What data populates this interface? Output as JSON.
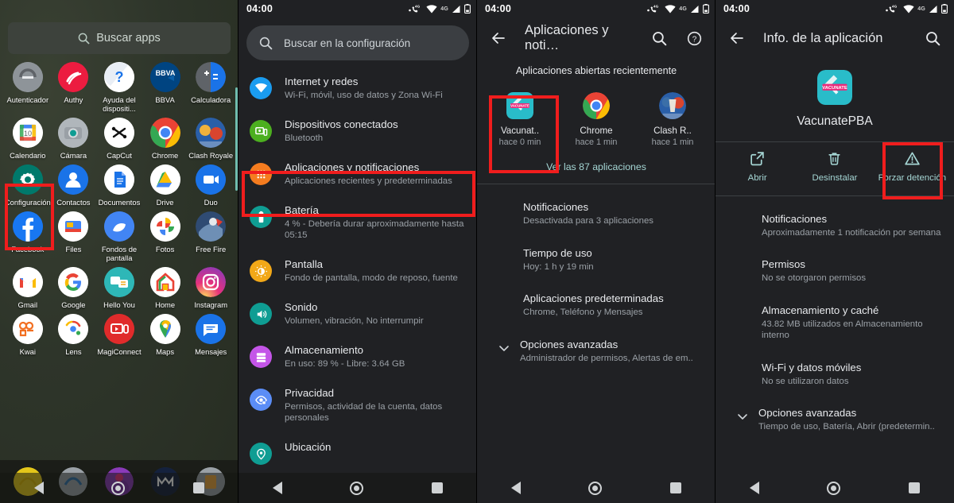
{
  "status_bar": {
    "time": "04:00",
    "network_label": "4G",
    "icons": [
      "phone-4g-icon",
      "wifi-icon",
      "signal-icon",
      "battery-icon"
    ]
  },
  "panel1": {
    "name": "App drawer",
    "search": {
      "placeholder": "Buscar apps",
      "icon": "search-icon"
    },
    "apps": [
      [
        {
          "label": "Autenticador",
          "icon": "authenticator-icon"
        },
        {
          "label": "Authy",
          "icon": "authy-icon"
        },
        {
          "label": "Ayuda del dispositi...",
          "icon": "device-help-icon"
        },
        {
          "label": "BBVA",
          "icon": "bbva-icon"
        },
        {
          "label": "Calculadora",
          "icon": "calculator-icon"
        }
      ],
      [
        {
          "label": "Calendario",
          "icon": "calendar-icon"
        },
        {
          "label": "Cámara",
          "icon": "camera-icon"
        },
        {
          "label": "CapCut",
          "icon": "capcut-icon"
        },
        {
          "label": "Chrome",
          "icon": "chrome-icon"
        },
        {
          "label": "Clash Royale",
          "icon": "clash-royale-icon"
        }
      ],
      [
        {
          "label": "Configuración",
          "icon": "settings-gear-icon"
        },
        {
          "label": "Contactos",
          "icon": "contacts-icon"
        },
        {
          "label": "Documentos",
          "icon": "docs-icon"
        },
        {
          "label": "Drive",
          "icon": "drive-icon"
        },
        {
          "label": "Duo",
          "icon": "duo-icon"
        }
      ],
      [
        {
          "label": "Facebook",
          "icon": "facebook-icon"
        },
        {
          "label": "Files",
          "icon": "files-icon"
        },
        {
          "label": "Fondos de pantalla",
          "icon": "wallpapers-icon"
        },
        {
          "label": "Fotos",
          "icon": "photos-icon"
        },
        {
          "label": "Free Fire",
          "icon": "free-fire-icon"
        }
      ],
      [
        {
          "label": "Gmail",
          "icon": "gmail-icon"
        },
        {
          "label": "Google",
          "icon": "google-icon"
        },
        {
          "label": "Hello You",
          "icon": "hello-you-icon"
        },
        {
          "label": "Home",
          "icon": "home-icon"
        },
        {
          "label": "Instagram",
          "icon": "instagram-icon"
        }
      ],
      [
        {
          "label": "Kwai",
          "icon": "kwai-icon"
        },
        {
          "label": "Lens",
          "icon": "lens-icon"
        },
        {
          "label": "MagiConnect",
          "icon": "magiconnect-icon"
        },
        {
          "label": "Maps",
          "icon": "maps-icon"
        },
        {
          "label": "Mensajes",
          "icon": "messages-icon"
        }
      ]
    ],
    "dock": [
      "dock-icon-1",
      "dock-icon-2",
      "dock-icon-3",
      "dock-icon-4",
      "dock-icon-5"
    ],
    "highlight": "Configuración"
  },
  "panel2": {
    "name": "Configuración",
    "search": {
      "placeholder": "Buscar en la configuración",
      "icon": "search-icon"
    },
    "items": [
      {
        "title": "Internet y redes",
        "subtitle": "Wi-Fi, móvil, uso de datos y Zona Wi-Fi",
        "icon": "wifi-icon",
        "color": "#1a9cf0"
      },
      {
        "title": "Dispositivos conectados",
        "subtitle": "Bluetooth",
        "icon": "devices-icon",
        "color": "#4caf1f"
      },
      {
        "title": "Aplicaciones y notificaciones",
        "subtitle": "Aplicaciones recientes y predeterminadas",
        "icon": "apps-grid-icon",
        "color": "#f57c1f"
      },
      {
        "title": "Batería",
        "subtitle": "4 % - Debería durar aproximadamente hasta 05:15",
        "icon": "battery-icon",
        "color": "#0f9d93"
      },
      {
        "title": "Pantalla",
        "subtitle": "Fondo de pantalla, modo de reposo, fuente",
        "icon": "brightness-icon",
        "color": "#f2a818"
      },
      {
        "title": "Sonido",
        "subtitle": "Volumen, vibración, No interrumpir",
        "icon": "volume-icon",
        "color": "#0f9d93"
      },
      {
        "title": "Almacenamiento",
        "subtitle": "En uso: 89 % - Libre: 3.64 GB",
        "icon": "storage-icon",
        "color": "#c455e8"
      },
      {
        "title": "Privacidad",
        "subtitle": "Permisos, actividad de la cuenta, datos personales",
        "icon": "privacy-eye-icon",
        "color": "#5b8df6"
      },
      {
        "title": "Ubicación",
        "subtitle": "",
        "icon": "location-pin-icon",
        "color": "#0f9d93"
      }
    ],
    "highlight": "Aplicaciones y notificaciones"
  },
  "panel3": {
    "name": "Aplicaciones y notificaciones",
    "appbar": {
      "title": "Aplicaciones y noti…",
      "back": "back-arrow-icon",
      "search": "search-icon",
      "help": "help-icon"
    },
    "section_title": "Aplicaciones abiertas recientemente",
    "recent_apps": [
      {
        "name": "Vacunat..",
        "time": "hace 0 min",
        "icon": "vacunatepba-icon"
      },
      {
        "name": "Chrome",
        "time": "hace 1 min",
        "icon": "chrome-icon"
      },
      {
        "name": "Clash R..",
        "time": "hace 1 min",
        "icon": "clash-royale-icon"
      }
    ],
    "see_all": "Ver las 87 aplicaciones",
    "items": [
      {
        "title": "Notificaciones",
        "subtitle": "Desactivada para 3 aplicaciones",
        "chevron": false
      },
      {
        "title": "Tiempo de uso",
        "subtitle": "Hoy: 1 h y 19 min",
        "chevron": false
      },
      {
        "title": "Aplicaciones predeterminadas",
        "subtitle": "Chrome, Teléfono y Mensajes",
        "chevron": false
      },
      {
        "title": "Opciones avanzadas",
        "subtitle": "Administrador de permisos, Alertas de em..",
        "chevron": true
      }
    ],
    "highlight": "Vacunat.."
  },
  "panel4": {
    "name": "Info. de la aplicación",
    "appbar": {
      "title": "Info. de la aplicación",
      "back": "back-arrow-icon",
      "search": "search-icon"
    },
    "app": {
      "name": "VacunatePBA",
      "icon": "vacunatepba-icon"
    },
    "actions": [
      {
        "label": "Abrir",
        "icon": "open-external-icon"
      },
      {
        "label": "Desinstalar",
        "icon": "trash-icon"
      },
      {
        "label": "Forzar detención",
        "icon": "warning-triangle-icon"
      }
    ],
    "items": [
      {
        "title": "Notificaciones",
        "subtitle": "Aproximadamente 1 notificación por semana",
        "chevron": false
      },
      {
        "title": "Permisos",
        "subtitle": "No se otorgaron permisos",
        "chevron": false
      },
      {
        "title": "Almacenamiento y caché",
        "subtitle": "43.82 MB utilizados en Almacenamiento interno",
        "chevron": false
      },
      {
        "title": "Wi-Fi y datos móviles",
        "subtitle": "No se utilizaron datos",
        "chevron": false
      },
      {
        "title": "Opciones avanzadas",
        "subtitle": "Tiempo de uso, Batería, Abrir (predetermin..",
        "chevron": true
      }
    ],
    "highlight": "Forzar detención"
  },
  "nav_bar": {
    "back": "nav-back-icon",
    "home": "nav-home-icon",
    "recents": "nav-recents-icon"
  },
  "colors": {
    "highlight": "#f01d1d",
    "accent": "#a5d6d4",
    "bg_dark": "#202124",
    "wallpaper": "#30372b"
  }
}
